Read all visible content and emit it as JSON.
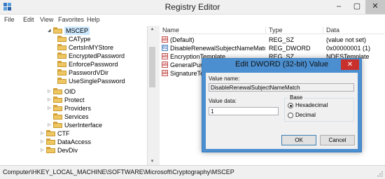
{
  "window": {
    "title": "Registry Editor",
    "minimize_glyph": "–",
    "maximize_glyph": "▢",
    "close_glyph": "✕"
  },
  "menu": [
    "File",
    "Edit",
    "View",
    "Favorites",
    "Help"
  ],
  "tree": {
    "items": [
      {
        "label": "MSCEP",
        "expander": "◢",
        "selected": true
      },
      {
        "label": "CAType",
        "expander": ""
      },
      {
        "label": "CertsInMYStore",
        "expander": ""
      },
      {
        "label": "EncryptedPassword",
        "expander": ""
      },
      {
        "label": "EnforcePassword",
        "expander": ""
      },
      {
        "label": "PasswordVDir",
        "expander": ""
      },
      {
        "label": "UseSinglePassword",
        "expander": ""
      },
      {
        "label": "OID",
        "expander": "▷"
      },
      {
        "label": "Protect",
        "expander": "▷"
      },
      {
        "label": "Providers",
        "expander": "▷"
      },
      {
        "label": "Services",
        "expander": ""
      },
      {
        "label": "UserInterface",
        "expander": "▷"
      },
      {
        "label": "CTF",
        "expander": "▷"
      },
      {
        "label": "DataAccess",
        "expander": "▷"
      },
      {
        "label": "DevDiv",
        "expander": "▷"
      }
    ]
  },
  "list": {
    "columns": [
      "Name",
      "Type",
      "Data"
    ],
    "rows": [
      {
        "icon": "ab",
        "icon_kind": "sz",
        "name": "(Default)",
        "type": "REG_SZ",
        "data": "(value not set)"
      },
      {
        "icon": "01",
        "icon_kind": "dw",
        "name": "DisableRenewalSubjectNameMatch",
        "type": "REG_DWORD",
        "data": "0x00000001 (1)"
      },
      {
        "icon": "ab",
        "icon_kind": "sz",
        "name": "EncryptionTemplate",
        "type": "REG_SZ",
        "data": "NDESTemplate"
      },
      {
        "icon": "ab",
        "icon_kind": "sz",
        "name": "GeneralPurposeTemplate",
        "type": "",
        "data": ""
      },
      {
        "icon": "ab",
        "icon_kind": "sz",
        "name": "SignatureTemplate",
        "type": "",
        "data": ""
      }
    ]
  },
  "status": {
    "path": "Computer\\HKEY_LOCAL_MACHINE\\SOFTWARE\\Microsoft\\Cryptography\\MSCEP"
  },
  "dialog": {
    "title": "Edit DWORD (32-bit) Value",
    "close_glyph": "✕",
    "value_name_label": "Value name:",
    "value_name": "DisableRenewalSubjectNameMatch",
    "value_data_label": "Value data:",
    "value_data": "1",
    "base_label": "Base",
    "hex_label": "Hexadecimal",
    "dec_label": "Decimal",
    "base_selected": "Hexadecimal",
    "ok_label": "OK",
    "cancel_label": "Cancel"
  }
}
